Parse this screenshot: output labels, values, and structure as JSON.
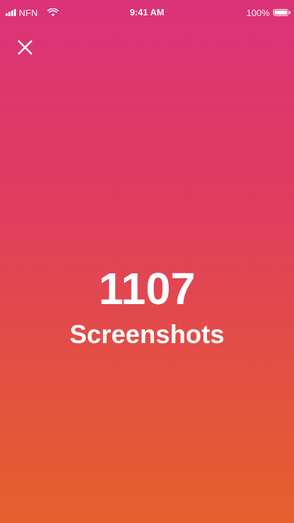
{
  "status_bar": {
    "carrier": "NFN",
    "time": "9:41 AM",
    "battery": "100%",
    "signal_icon": "signal-bars-icon",
    "wifi_icon": "wifi-icon",
    "battery_icon": "battery-full-icon",
    "battery_level": 1.0
  },
  "toolbar": {
    "close_icon": "close-icon"
  },
  "summary": {
    "count": "1107",
    "label": "Screenshots"
  },
  "colors": {
    "gradient_top": "#dc3278",
    "gradient_bottom": "#e6602e",
    "text": "#ffffff"
  }
}
